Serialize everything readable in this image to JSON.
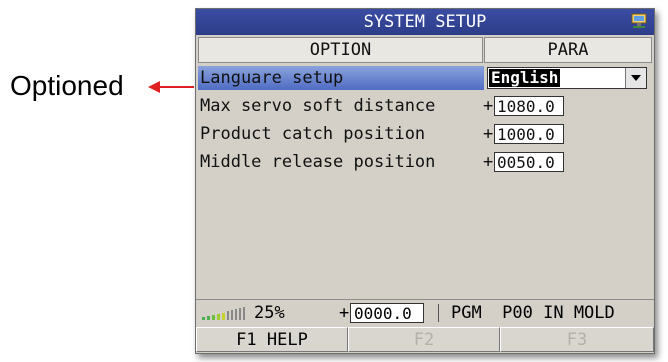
{
  "callout": {
    "text": "Optioned",
    "arrow_color": "#e02020"
  },
  "window": {
    "title": "SYSTEM SETUP",
    "icon": "network-computer-icon"
  },
  "table": {
    "headers": {
      "option": "OPTION",
      "para": "PARA"
    },
    "rows": [
      {
        "label": "Languare setup",
        "type": "select",
        "value": "English",
        "selected": true
      },
      {
        "label": "Max servo soft distance",
        "sign": "+",
        "value": "1080.0"
      },
      {
        "label": "Product catch position",
        "sign": "+",
        "value": "1000.0"
      },
      {
        "label": "Middle release position",
        "sign": "+",
        "value": "0050.0"
      }
    ]
  },
  "status": {
    "signal_icon": "signal-strength-icon",
    "percent": "25%",
    "sign": "+",
    "value": "0000.0",
    "text": "PGM  P00 IN MOLD"
  },
  "fkeys": [
    {
      "label": "F1 HELP",
      "enabled": true
    },
    {
      "label": "F2",
      "enabled": false
    },
    {
      "label": "F3",
      "enabled": false
    }
  ],
  "colors": {
    "title_bar": "#2c3c88",
    "selection": "#4f6cc3",
    "panel": "#d4d0c8"
  }
}
